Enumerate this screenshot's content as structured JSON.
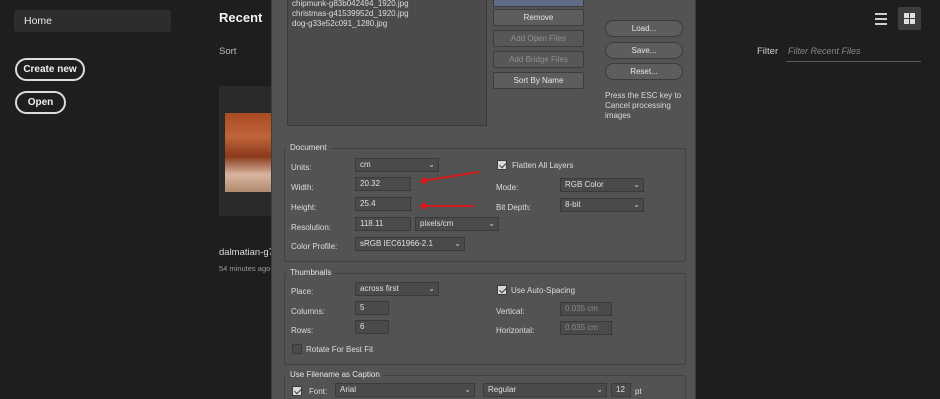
{
  "home": {
    "nav_home": "Home",
    "create_new": "Create new",
    "open": "Open",
    "recent_title": "Recent",
    "sort_label": "Sort",
    "filter_label": "Filter",
    "filter_placeholder": "Filter Recent Files",
    "recent_file": {
      "name": "dalmatian-g7",
      "time": "54 minutes ago"
    }
  },
  "dialog": {
    "files": [
      "chipmunk-g83b042494_1920.jpg",
      "christmas-g41539952d_1920.jpg",
      "dog-g33e52c091_1280.jpg"
    ],
    "buttons": {
      "remove": "Remove",
      "add_open_files": "Add Open Files",
      "add_bridge_files": "Add Bridge Files",
      "sort_by_name": "Sort By Name",
      "load": "Load...",
      "save": "Save...",
      "reset": "Reset..."
    },
    "esc_note": "Press the ESC key to Cancel processing images",
    "document": {
      "title": "Document",
      "units_label": "Units:",
      "units_value": "cm",
      "width_label": "Width:",
      "width_value": "20.32",
      "height_label": "Height:",
      "height_value": "25.4",
      "resolution_label": "Resolution:",
      "resolution_value": "118.11",
      "resolution_unit": "pixels/cm",
      "color_profile_label": "Color Profile:",
      "color_profile_value": "sRGB IEC61966-2.1",
      "flatten_label": "Flatten All Layers",
      "flatten_checked": true,
      "mode_label": "Mode:",
      "mode_value": "RGB Color",
      "bit_depth_label": "Bit Depth:",
      "bit_depth_value": "8-bit"
    },
    "thumbnails": {
      "title": "Thumbnails",
      "place_label": "Place:",
      "place_value": "across first",
      "columns_label": "Columns:",
      "columns_value": "5",
      "rows_label": "Rows:",
      "rows_value": "6",
      "rotate_label": "Rotate For Best Fit",
      "rotate_checked": false,
      "auto_spacing_label": "Use Auto-Spacing",
      "auto_spacing_checked": true,
      "vertical_label": "Vertical:",
      "vertical_value": "0.035 cm",
      "horizontal_label": "Horizontal:",
      "horizontal_value": "0.035 cm"
    },
    "caption": {
      "title": "Use Filename as Caption",
      "enabled": true,
      "font_label": "Font:",
      "font_value": "Arial",
      "style_value": "Regular",
      "size_value": "12",
      "size_unit": "pt"
    }
  },
  "colors": {
    "arrow": "#d71818",
    "dialog_bg": "#535353",
    "app_bg": "#1e1e1e"
  }
}
